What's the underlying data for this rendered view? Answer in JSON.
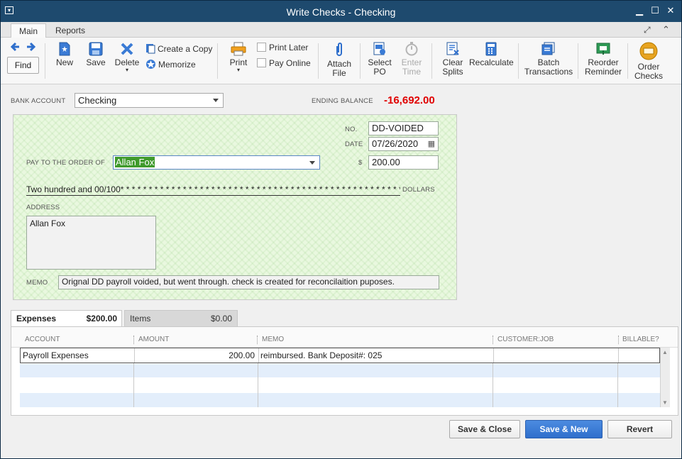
{
  "window": {
    "title": "Write Checks - Checking"
  },
  "tabs": [
    {
      "label": "Main"
    },
    {
      "label": "Reports"
    }
  ],
  "toolbar": {
    "find": "Find",
    "new": "New",
    "save": "Save",
    "delete": "Delete",
    "create_copy": "Create a Copy",
    "memorize": "Memorize",
    "print": "Print",
    "print_later": "Print Later",
    "pay_online": "Pay Online",
    "attach_file_1": "Attach",
    "attach_file_2": "File",
    "select_po_1": "Select",
    "select_po_2": "PO",
    "enter_time_1": "Enter",
    "enter_time_2": "Time",
    "clear_splits_1": "Clear",
    "clear_splits_2": "Splits",
    "recalculate": "Recalculate",
    "batch_1": "Batch",
    "batch_2": "Transactions",
    "reorder_1": "Reorder",
    "reorder_2": "Reminder",
    "order_checks_1": "Order",
    "order_checks_2": "Checks"
  },
  "bank": {
    "label": "BANK ACCOUNT",
    "value": "Checking",
    "ending_label": "ENDING BALANCE",
    "ending_value": "-16,692.00"
  },
  "check": {
    "no_label": "NO.",
    "no_value": "DD-VOIDED",
    "date_label": "DATE",
    "date_value": "07/26/2020",
    "payto_label": "PAY TO THE ORDER OF",
    "payee": "Allan Fox",
    "dollar_sign": "$",
    "amount": "200.00",
    "amount_words": "Two hundred and 00/100* * * * * * * * * * * * * * * * * * * * * * * * * * * * * * * * * * * * * * * * * * * * * * * * * * * * * *",
    "dollars_label": "DOLLARS",
    "address_label": "ADDRESS",
    "address": "Allan Fox",
    "memo_label": "MEMO",
    "memo": "Orignal DD payroll voided, but went through. check is created for reconcilaition puposes."
  },
  "lower_tabs": [
    {
      "label": "Expenses",
      "amount": "$200.00"
    },
    {
      "label": "Items",
      "amount": "$0.00"
    }
  ],
  "grid": {
    "headers": [
      "ACCOUNT",
      "AMOUNT",
      "MEMO",
      "CUSTOMER:JOB",
      "BILLABLE?"
    ],
    "rows": [
      {
        "account": "Payroll Expenses",
        "amount": "200.00",
        "memo": "reimbursed. Bank Deposit#: 025",
        "customer": "",
        "billable": ""
      }
    ]
  },
  "buttons": {
    "save_close": "Save & Close",
    "save_new": "Save & New",
    "revert": "Revert"
  },
  "colors": {
    "titlebar": "#1e4a6e",
    "negative_balance": "#e00000",
    "check_bg": "#e9f8df",
    "primary_button": "#2f6fcc"
  }
}
